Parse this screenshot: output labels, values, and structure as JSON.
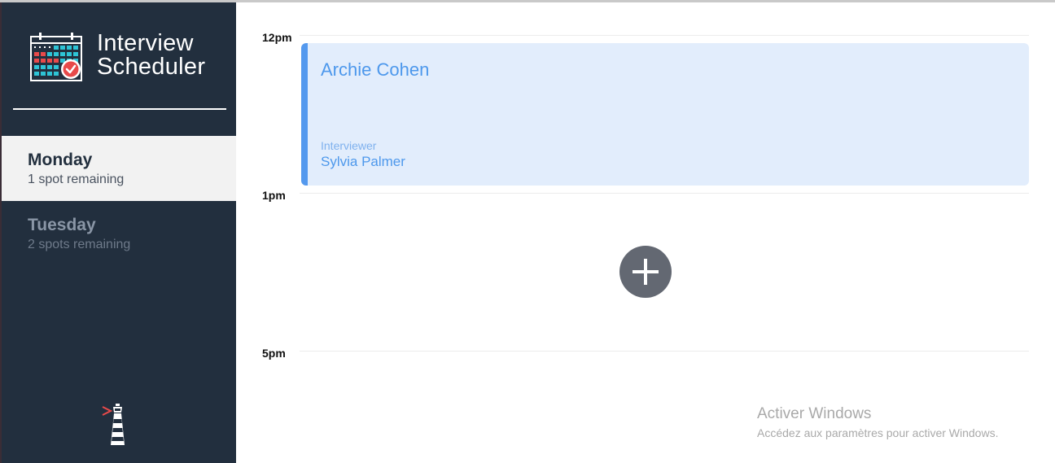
{
  "app": {
    "title_line1": "Interview",
    "title_line2": "Scheduler"
  },
  "days": [
    {
      "name": "Monday",
      "spots": "1 spot remaining",
      "selected": true
    },
    {
      "name": "Tuesday",
      "spots": "2 spots remaining",
      "selected": false
    }
  ],
  "schedule": {
    "slots": [
      {
        "time": "12pm"
      },
      {
        "time": "1pm"
      },
      {
        "time": "5pm"
      }
    ],
    "appointment": {
      "student": "Archie Cohen",
      "interviewer_label": "Interviewer",
      "interviewer_name": "Sylvia Palmer"
    }
  },
  "watermark": {
    "line1": "Activer Windows",
    "line2": "Accédez aux paramètres pour activer Windows."
  },
  "colors": {
    "sidebar": "#222f3e",
    "accent": "#5499ee",
    "appointment_bg": "#e2edfc",
    "add_button": "#636872"
  },
  "icons": [
    "calendar-check-icon",
    "lighthouse-icon",
    "plus-icon"
  ]
}
